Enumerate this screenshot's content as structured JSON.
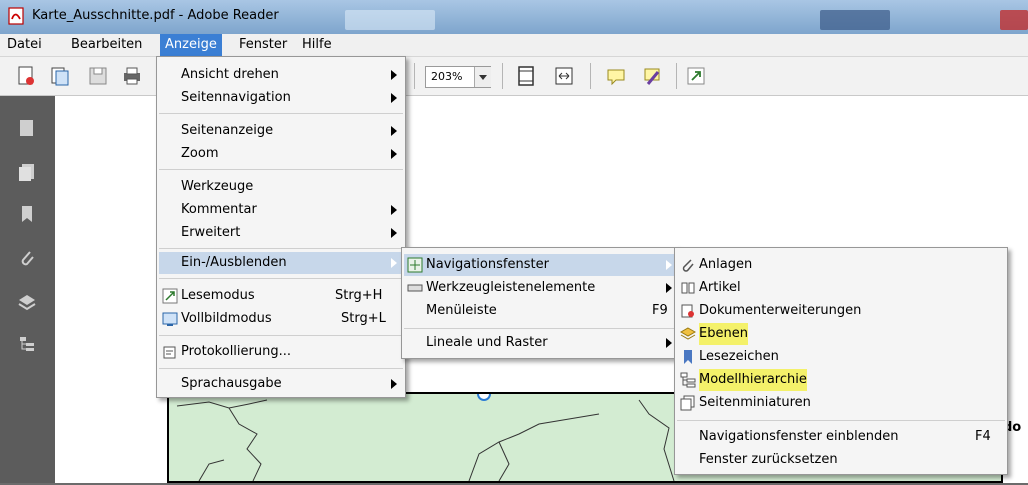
{
  "window": {
    "title": "Karte_Ausschnitte.pdf - Adobe Reader"
  },
  "menubar": [
    "Datei",
    "Bearbeiten",
    "Anzeige",
    "Fenster",
    "Hilfe"
  ],
  "toolbar": {
    "zoom": "203%"
  },
  "anzeige_menu": {
    "ansicht_drehen": "Ansicht drehen",
    "seitennavigation": "Seitennavigation",
    "seitenanzeige": "Seitenanzeige",
    "zoom": "Zoom",
    "werkzeuge": "Werkzeuge",
    "kommentar": "Kommentar",
    "erweitert": "Erweitert",
    "ein_ausblenden": "Ein-/Ausblenden",
    "lesemodus": "Lesemodus",
    "lesemodus_sc": "Strg+H",
    "vollbildmodus": "Vollbildmodus",
    "vollbildmodus_sc": "Strg+L",
    "protokollierung": "Protokollierung...",
    "sprachausgabe": "Sprachausgabe"
  },
  "einausblenden_menu": {
    "navigationsfenster": "Navigationsfenster",
    "werkzeugleistenelemente": "Werkzeugleistenelemente",
    "menueleiste": "Menüleiste",
    "menueleiste_sc": "F9",
    "lineale": "Lineale und Raster"
  },
  "navigation_menu": {
    "anlagen": "Anlagen",
    "artikel": "Artikel",
    "dokumenterweiterungen": "Dokumenterweiterungen",
    "ebenen": "Ebenen",
    "lesezeichen": "Lesezeichen",
    "modellhierarchie": "Modellhierarchie",
    "seitenminiaturen": "Seitenminiaturen",
    "einblenden": "Navigationsfenster einblenden",
    "einblenden_sc": "F4",
    "zuruecksetzen": "Fenster zurücksetzen"
  },
  "document": {
    "edge_text": "do"
  },
  "colors": {
    "highlight": "#f4f16a",
    "menu_active": "#3b7fd4",
    "map_fill": "#d3ecd2"
  }
}
